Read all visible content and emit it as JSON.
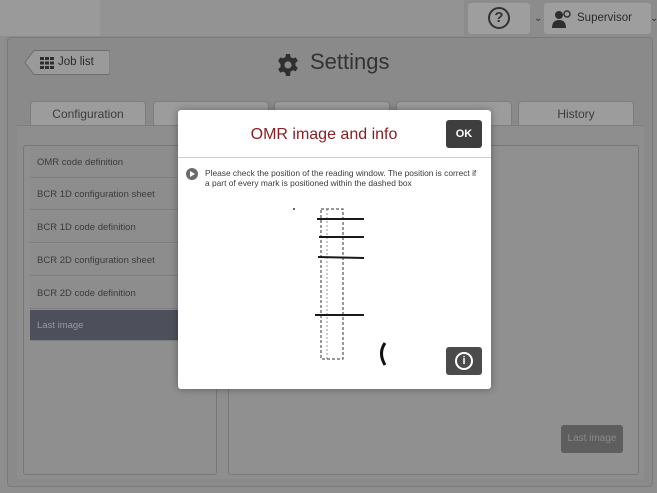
{
  "topbar": {
    "help_symbol": "?",
    "user_label": "Supervisor",
    "help_icon": "question-circle-icon",
    "user_icon": "user-gear-icon"
  },
  "header": {
    "back_label": "Job list",
    "back_icon": "grid-icon",
    "title": "Settings",
    "title_icon": "gear-icon"
  },
  "tabs": [
    {
      "label": "Configuration"
    },
    {
      "label": ""
    },
    {
      "label": ""
    },
    {
      "label": ""
    },
    {
      "label": "History"
    }
  ],
  "sidebar": {
    "items": [
      {
        "label": "OMR code definition"
      },
      {
        "label": "BCR 1D configuration sheet"
      },
      {
        "label": "BCR 1D code definition"
      },
      {
        "label": "BCR 2D configuration sheet"
      },
      {
        "label": "BCR 2D code definition"
      },
      {
        "label": "Last image",
        "active": true
      }
    ]
  },
  "right_pane": {
    "last_image_button": "Last image"
  },
  "modal": {
    "title": "OMR image and info",
    "ok_label": "OK",
    "instruction": "Please check the position of the reading window. The position is correct if a part of every mark is positioned within the dashed box",
    "info_symbol": "i",
    "info_icon": "info-circle-icon"
  },
  "colors": {
    "modal_title": "#8a1f24",
    "active_item_bg": "#4d4f5a",
    "overlay_bg": "#8e8e8e",
    "button_dark": "#3e3e3e"
  }
}
